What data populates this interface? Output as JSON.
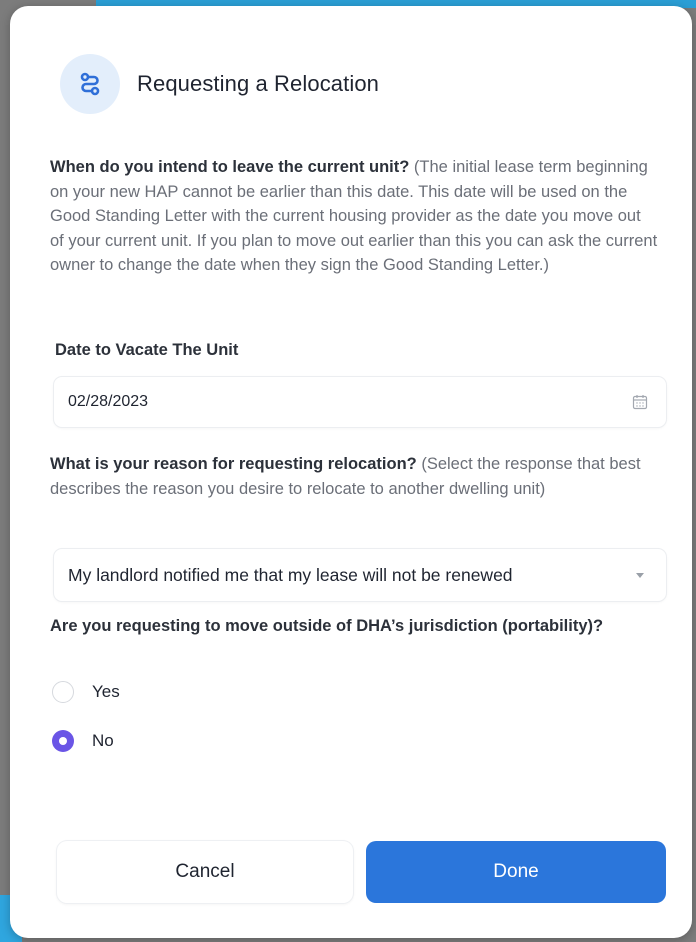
{
  "modal": {
    "title": "Requesting a Relocation",
    "header_icon": "route-icon"
  },
  "vacate": {
    "question_bold": "When do you intend to leave the current unit?",
    "question_rest": " (The initial lease term beginning on your new HAP cannot be earlier than this date. This date will be used on the Good Standing Letter with the current housing provider as the date you move out of your current unit. If you plan to move out earlier than this you can ask the current owner to change the date when they sign the Good Standing Letter.)",
    "label": "Date to Vacate The Unit",
    "date_value": "02/28/2023",
    "date_icon": "calendar-icon"
  },
  "reason": {
    "question_bold": "What is your reason for requesting relocation?",
    "question_rest": " (Select the response that best describes the reason you desire to relocate to another dwelling unit)",
    "selected": "My landlord notified me that my lease will not be renewed"
  },
  "portability": {
    "question_bold": "Are you requesting to move outside of DHA’s jurisdiction (portability)?",
    "options": [
      {
        "label": "Yes",
        "checked": false
      },
      {
        "label": "No",
        "checked": true
      }
    ]
  },
  "actions": {
    "cancel_label": "Cancel",
    "done_label": "Done"
  },
  "colors": {
    "primary": "#2b76db",
    "radio_selected": "#6a55e6",
    "icon_bg": "#e3eefb",
    "icon_fg": "#2f6fd8"
  }
}
